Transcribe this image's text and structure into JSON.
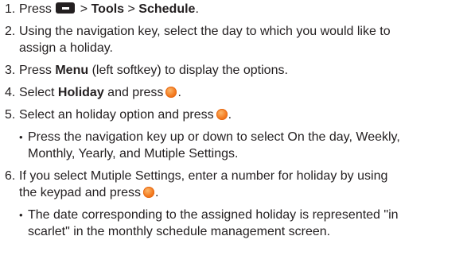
{
  "icons": {
    "menu_key": "menu-key-icon",
    "ok_key": "ok-key-icon",
    "ok_key_color": "#f47b20"
  },
  "steps": [
    {
      "num": "1.",
      "t1": "Press ",
      "t2": " > ",
      "tools": "Tools",
      "t3": " > ",
      "schedule": "Schedule",
      "t4": "."
    },
    {
      "num": "2.",
      "line1": "Using the navigation key, select the day to which you would like to",
      "line2": "assign a holiday."
    },
    {
      "num": "3.",
      "t1": "Press ",
      "menu": "Menu",
      "t2": " (left softkey) to display the options."
    },
    {
      "num": "4.",
      "t1": "Select ",
      "holiday": "Holiday",
      "t2": " and press",
      "t3": "."
    },
    {
      "num": "5.",
      "t1": "Select an holiday option and press",
      "t2": ".",
      "bullet": "•",
      "sub_line1": "Press the navigation key up or down to select On the day, Weekly,",
      "sub_line2": "Monthly, Yearly, and Mutiple Settings."
    },
    {
      "num": "6.",
      "line1": "If you select Mutiple Settings, enter a number for holiday by using",
      "line2a": "the keypad and press",
      "line2b": ".",
      "bullet": "•",
      "sub_line1": "The date corresponding to the assigned holiday is represented \"in",
      "sub_line2": "scarlet\" in the monthly schedule management screen."
    }
  ]
}
